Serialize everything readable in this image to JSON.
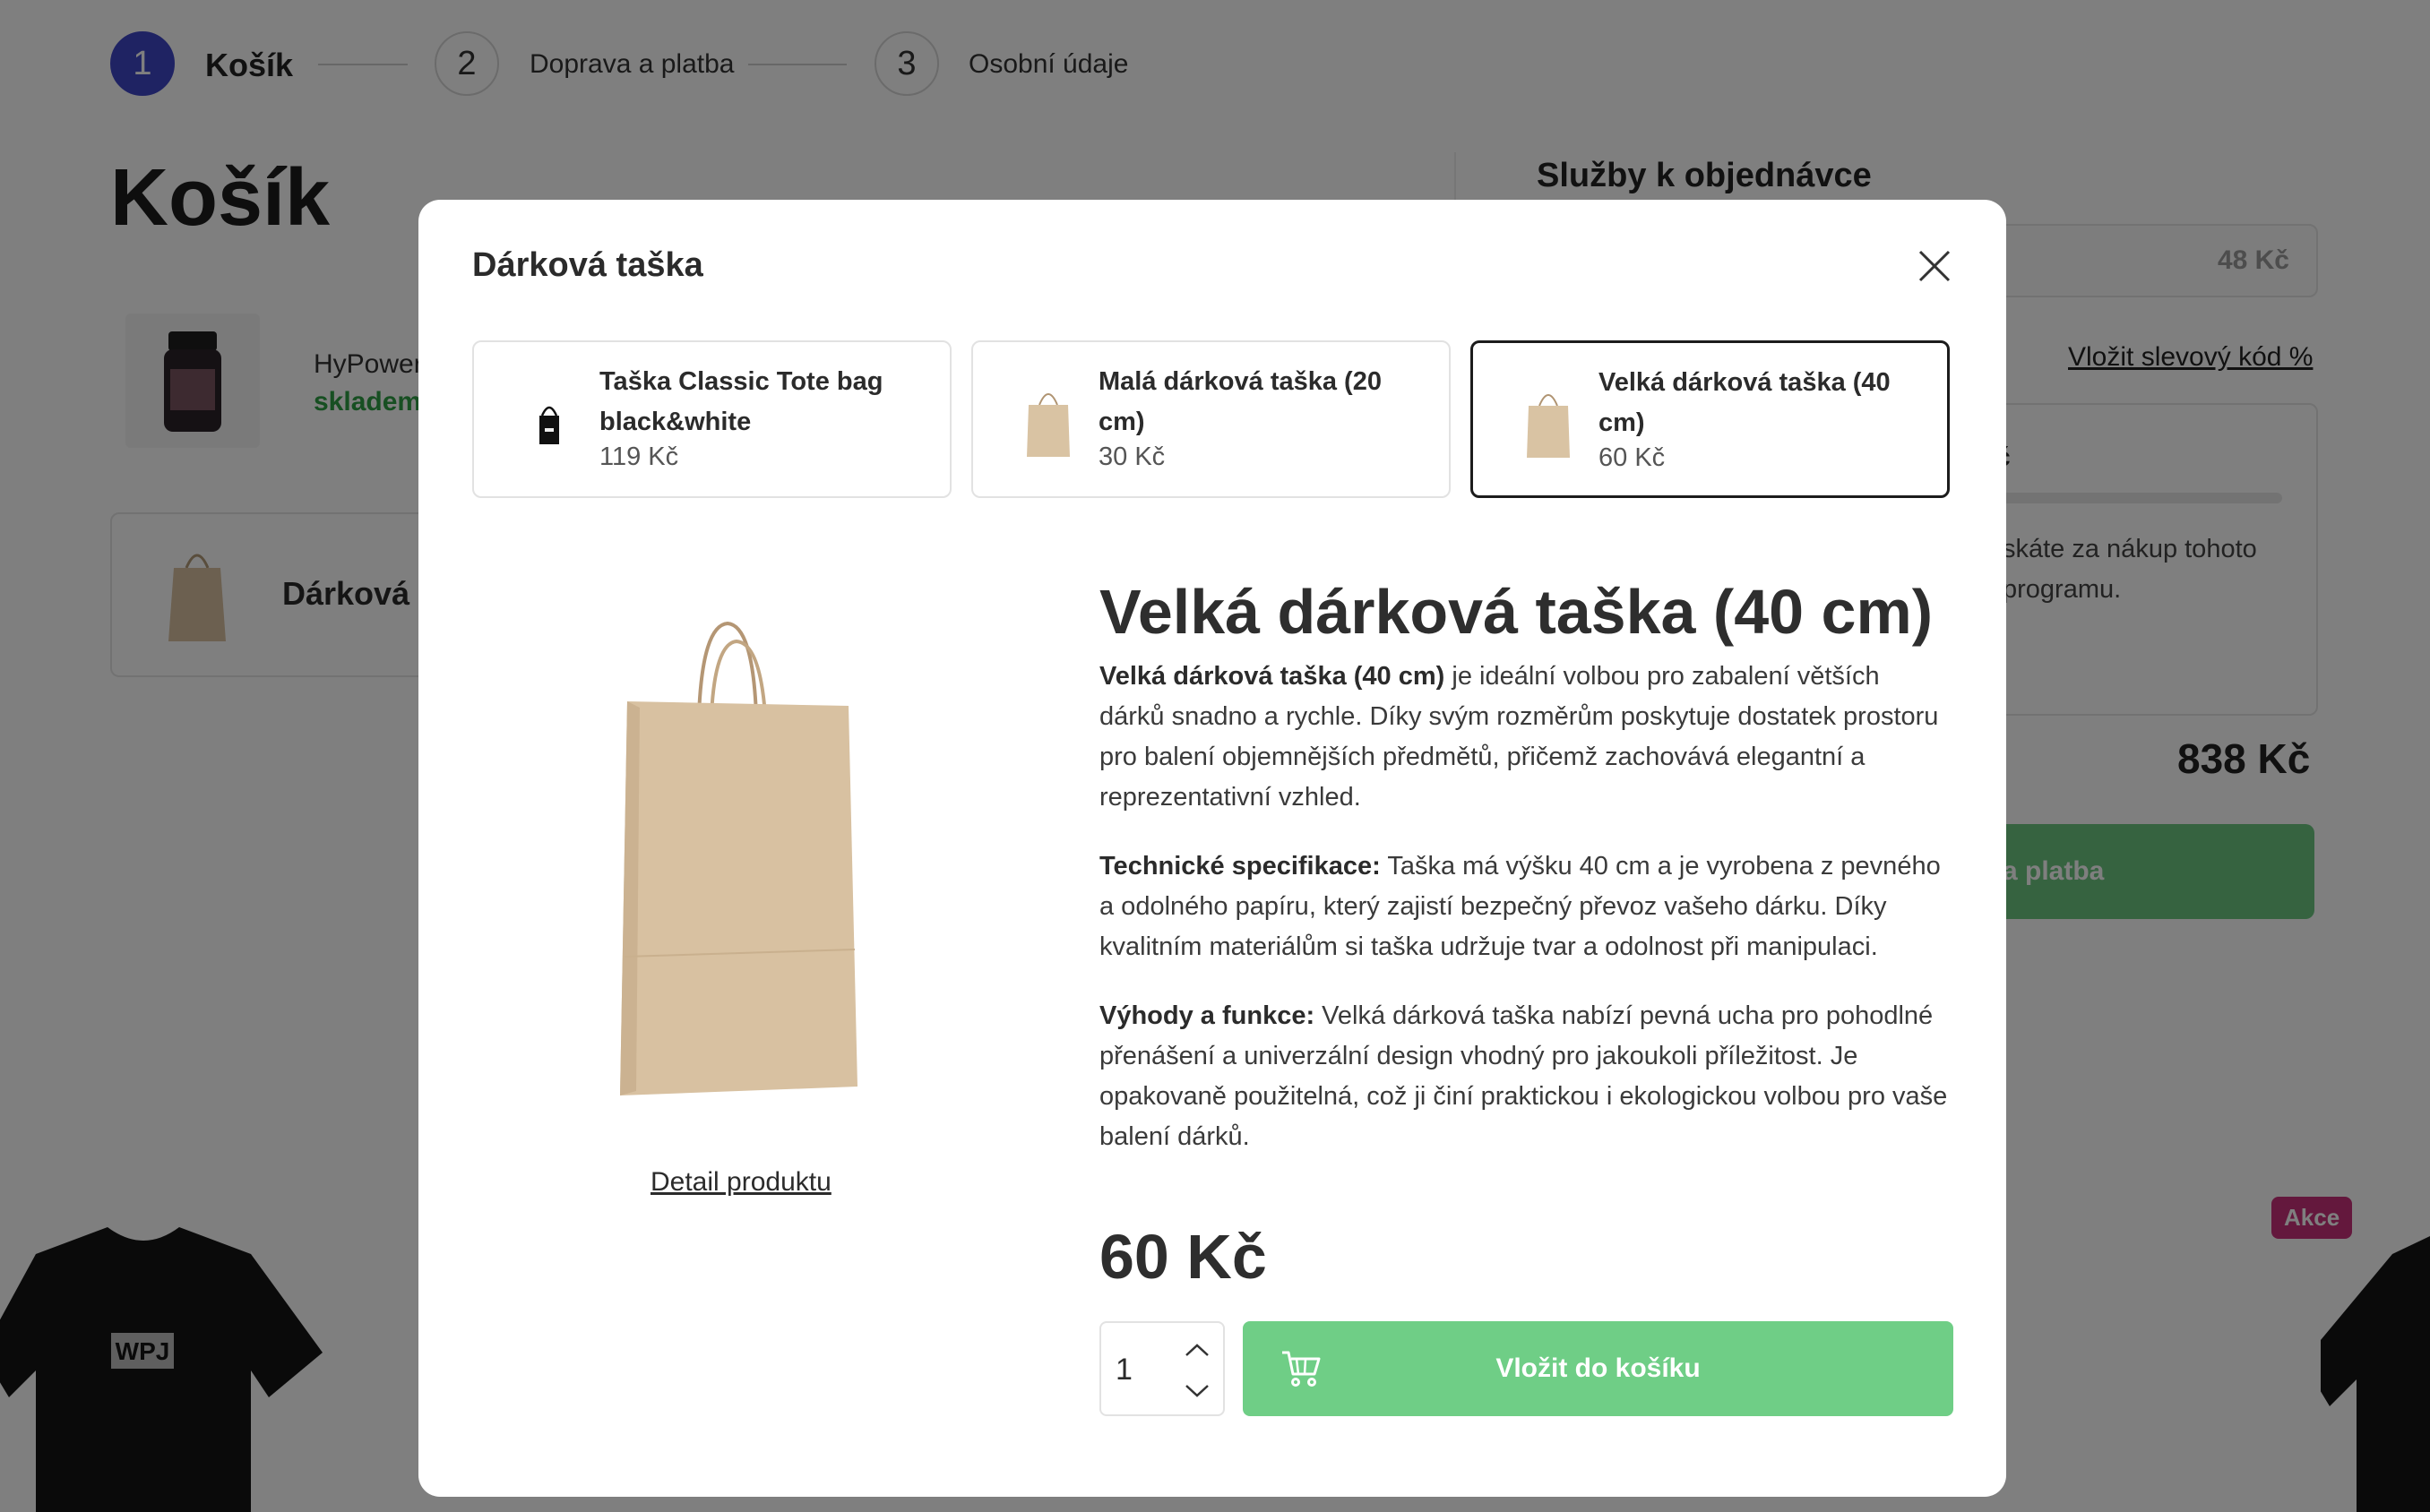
{
  "steps": [
    {
      "number": "1",
      "label": "Košík"
    },
    {
      "number": "2",
      "label": "Doprava a platba"
    },
    {
      "number": "3",
      "label": "Osobní údaje"
    }
  ],
  "cart": {
    "title": "Košík",
    "item_name": "HyPower",
    "item_stock": "skladem",
    "bag_item_name": "Dárková"
  },
  "sidebar": {
    "title": "Služby k objednávce",
    "service_price": "48 Kč",
    "discount_link": "Vložit slevový kód %",
    "loyalty_heading": "č",
    "loyalty_text_1": "skáte za nákup tohoto",
    "loyalty_text_2": "programu.",
    "total": "838 Kč",
    "continue_label": "a platba",
    "note": "!"
  },
  "promo_badge": "Akce",
  "tshirt_logo": "WPJ",
  "modal": {
    "title": "Dárková taška",
    "variants": [
      {
        "name": "Taška Classic Tote bag black&white",
        "price": "119 Kč"
      },
      {
        "name": "Malá dárková taška (20 cm)",
        "price": "30 Kč"
      },
      {
        "name": "Velká dárková taška (40 cm)",
        "price": "60 Kč"
      }
    ],
    "selected_variant": "Velká dárková taška (40 cm)",
    "detail_link": "Detail produktu",
    "product": {
      "title": "Velká dárková taška (40 cm)",
      "para1_bold": "Velká dárková taška (40 cm)",
      "para1_text": " je ideální volbou pro zabalení větších dárků snadno a rychle. Díky svým rozměrům poskytuje dostatek prostoru pro balení objemnějších předmětů, přičemž zachovává elegantní a reprezentativní vzhled.",
      "para2_bold": "Technické specifikace:",
      "para2_text": " Taška má výšku 40 cm a je vyrobena z pevného a odolného papíru, který zajistí bezpečný převoz vašeho dárku. Díky kvalitním materiálům si taška udržuje tvar a odolnost při manipulaci.",
      "para3_bold": "Výhody a funkce:",
      "para3_text": " Velká dárková taška nabízí pevná ucha pro pohodlné přenášení a univerzální design vhodný pro jakoukoli příležitost. Je opakovaně použitelná, což ji činí praktickou i ekologickou volbou pro vaše balení dárků.",
      "price": "60 Kč"
    },
    "quantity": "1",
    "add_to_cart_label": "Vložit do košíku"
  },
  "colors": {
    "step_active": "#3f46c6",
    "add_button": "#6fce86",
    "stock_green": "#2f9e44",
    "promo_badge": "#c8317a"
  }
}
